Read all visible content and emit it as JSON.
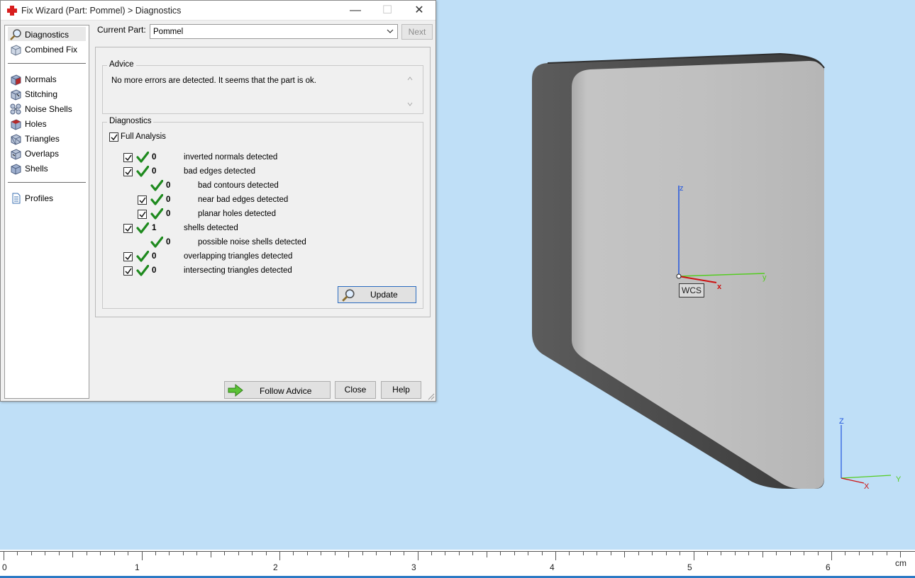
{
  "window": {
    "title": "Fix Wizard (Part: Pommel) > Diagnostics",
    "controls": {
      "minimize": "—",
      "maximize": "☐",
      "close": "✕"
    }
  },
  "sidebar": {
    "items": [
      {
        "label": "Diagnostics",
        "icon": "magnifier-icon",
        "selected": true
      },
      {
        "label": "Combined Fix",
        "icon": "cube-icon"
      },
      {
        "label": "Normals",
        "icon": "normals-cube-icon"
      },
      {
        "label": "Stitching",
        "icon": "stitching-cube-icon"
      },
      {
        "label": "Noise Shells",
        "icon": "noise-shells-icon"
      },
      {
        "label": "Holes",
        "icon": "holes-cube-icon"
      },
      {
        "label": "Triangles",
        "icon": "triangles-cube-icon"
      },
      {
        "label": "Overlaps",
        "icon": "overlaps-cube-icon"
      },
      {
        "label": "Shells",
        "icon": "shells-cube-icon"
      },
      {
        "label": "Profiles",
        "icon": "document-icon"
      }
    ]
  },
  "current_part": {
    "label": "Current Part:",
    "value": "Pommel"
  },
  "buttons": {
    "next": "Next",
    "update": "Update",
    "follow_advice": "Follow Advice",
    "close": "Close",
    "help": "Help"
  },
  "advice": {
    "title": "Advice",
    "text": "No more errors are detected. It seems that the part is ok."
  },
  "diagnostics": {
    "title": "Diagnostics",
    "full_analysis": {
      "label": "Full Analysis",
      "checked": true
    },
    "rows": [
      {
        "count": "0",
        "label": "inverted normals detected",
        "checkbox": true,
        "indent": 0
      },
      {
        "count": "0",
        "label": "bad edges detected",
        "checkbox": true,
        "indent": 0
      },
      {
        "count": "0",
        "label": "bad contours detected",
        "checkbox": false,
        "indent": 1
      },
      {
        "count": "0",
        "label": "near bad edges detected",
        "checkbox": true,
        "indent": 1
      },
      {
        "count": "0",
        "label": "planar holes detected",
        "checkbox": true,
        "indent": 1
      },
      {
        "count": "1",
        "label": "shells detected",
        "checkbox": true,
        "indent": 0
      },
      {
        "count": "0",
        "label": "possible noise shells detected",
        "checkbox": false,
        "indent": 1
      },
      {
        "count": "0",
        "label": "overlapping triangles detected",
        "checkbox": true,
        "indent": 0
      },
      {
        "count": "0",
        "label": "intersecting triangles detected",
        "checkbox": true,
        "indent": 0
      }
    ]
  },
  "viewport": {
    "wcs_label": "WCS",
    "local_axes": {
      "x": "x",
      "y": "y",
      "z": "z"
    },
    "corner_axes": {
      "x": "X",
      "y": "Y",
      "z": "Z"
    },
    "colors": {
      "background": "#bfdff7",
      "x_axis": "#cc1111",
      "y_axis": "#55cc22",
      "z_axis": "#2255dd"
    }
  },
  "ruler": {
    "unit": "cm",
    "labels": [
      "0",
      "1",
      "2",
      "3",
      "4",
      "5",
      "6"
    ]
  }
}
